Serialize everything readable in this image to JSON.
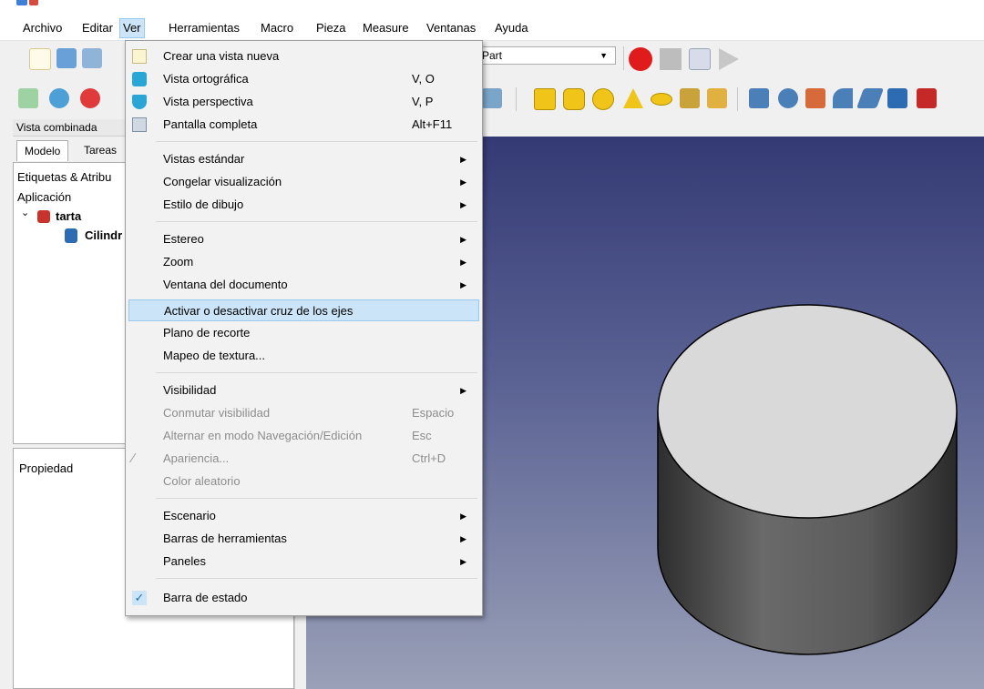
{
  "menubar": {
    "items": [
      "Archivo",
      "Editar",
      "Ver",
      "Herramientas",
      "Macro",
      "Pieza",
      "Measure",
      "Ventanas",
      "Ayuda"
    ],
    "active": "Ver"
  },
  "workbench_select": {
    "value": "Part"
  },
  "combo_view": {
    "title": "Vista combinada",
    "tabs": [
      "Modelo",
      "Tareas"
    ],
    "active_tab": "Modelo"
  },
  "tree": {
    "labels_header": "Etiquetas & Atribu",
    "application": "Aplicación",
    "document": "tarta",
    "object": "Cilindr"
  },
  "property_panel": {
    "header": "Propiedad"
  },
  "view_menu": {
    "items": [
      {
        "label": "Crear una vista nueva",
        "shortcut": "",
        "icon": "new-view-icon"
      },
      {
        "label": "Vista ortográfica",
        "shortcut": "V, O",
        "icon": "orthographic-cube-icon"
      },
      {
        "label": "Vista perspectiva",
        "shortcut": "V, P",
        "icon": "perspective-cube-icon"
      },
      {
        "label": "Pantalla completa",
        "shortcut": "Alt+F11",
        "icon": "fullscreen-icon"
      },
      {
        "label": "Vistas estándar",
        "submenu": true
      },
      {
        "label": "Congelar visualización",
        "submenu": true
      },
      {
        "label": "Estilo de dibujo",
        "submenu": true
      },
      {
        "label": "Estereo",
        "submenu": true
      },
      {
        "label": "Zoom",
        "submenu": true
      },
      {
        "label": "Ventana del documento",
        "submenu": true
      },
      {
        "label": "Activar o desactivar cruz de los ejes",
        "highlighted": true
      },
      {
        "label": "Plano de recorte"
      },
      {
        "label": "Mapeo de textura..."
      },
      {
        "label": "Visibilidad",
        "submenu": true
      },
      {
        "label": "Conmutar visibilidad",
        "shortcut": "Espacio",
        "disabled": true
      },
      {
        "label": "Alternar en modo Navegación/Edición",
        "shortcut": "Esc",
        "disabled": true
      },
      {
        "label": "Apariencia...",
        "shortcut": "Ctrl+D",
        "disabled": true,
        "icon": "appearance-brush-icon"
      },
      {
        "label": "Color aleatorio",
        "disabled": true
      },
      {
        "label": "Escenario",
        "submenu": true
      },
      {
        "label": "Barras de herramientas",
        "submenu": true
      },
      {
        "label": "Paneles",
        "submenu": true
      },
      {
        "label": "Barra de estado",
        "checked": true,
        "icon": "checkmark-icon"
      }
    ]
  },
  "colors": {
    "menu_highlight": "#cce4f7",
    "menu_highlight_border": "#99c9ef",
    "viewport_top": "#343a74",
    "viewport_bottom": "#9aa0b7",
    "cylinder_top": "#d9d9d9",
    "cylinder_side": "#555555"
  }
}
